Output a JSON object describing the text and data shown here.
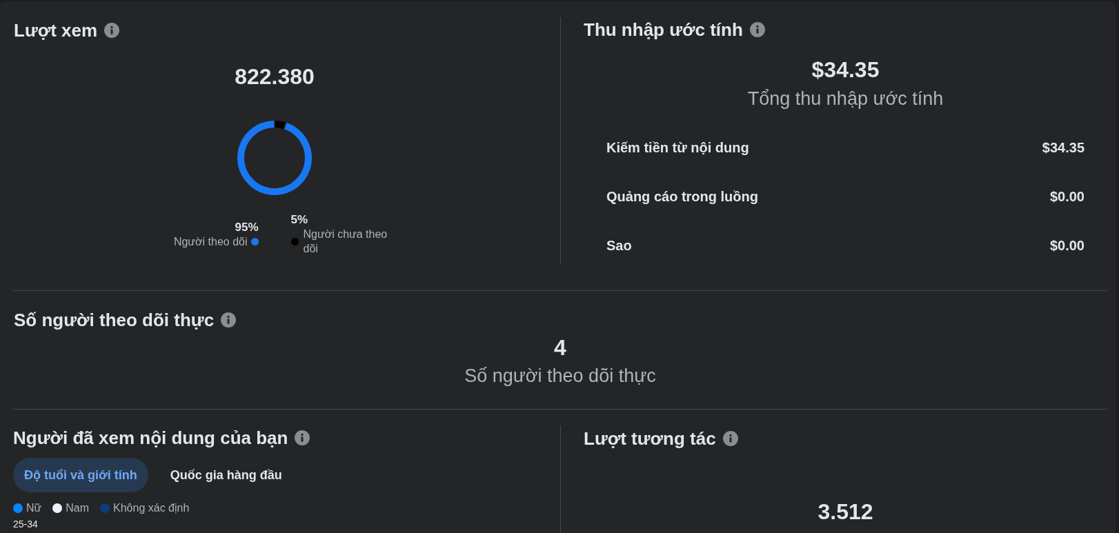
{
  "views": {
    "title": "Lượt xem",
    "total": "822.380",
    "chart_data": {
      "type": "donut",
      "categories": [
        "Người theo dõi",
        "Người chưa theo dõi"
      ],
      "values": [
        95,
        5
      ],
      "value_labels": [
        "95%",
        "5%"
      ],
      "colors": [
        "#1877f2",
        "#000000"
      ]
    }
  },
  "earnings": {
    "title": "Thu nhập ước tính",
    "total": "$34.35",
    "caption": "Tổng thu nhập ước tính",
    "rows": [
      {
        "label": "Kiếm tiền từ nội dung",
        "value": "$34.35"
      },
      {
        "label": "Quảng cáo trong luồng",
        "value": "$0.00"
      },
      {
        "label": "Sao",
        "value": "$0.00"
      }
    ]
  },
  "followers": {
    "title": "Số người theo dõi thực",
    "count": "4",
    "caption": "Số người theo dõi thực"
  },
  "audience": {
    "title": "Người đã xem nội dung của bạn",
    "tabs": [
      {
        "label": "Độ tuổi và giới tính",
        "selected": true
      },
      {
        "label": "Quốc gia hàng đầu",
        "selected": false
      }
    ],
    "legend": [
      {
        "label": "Nữ",
        "color": "#0a84ff"
      },
      {
        "label": "Nam",
        "color": "#e9f2fc"
      },
      {
        "label": "Không xác định",
        "color": "#0b3d7a"
      }
    ],
    "age_groups": [
      {
        "label": "25-34"
      }
    ]
  },
  "engagement": {
    "title": "Lượt tương tác",
    "total": "3.512"
  }
}
